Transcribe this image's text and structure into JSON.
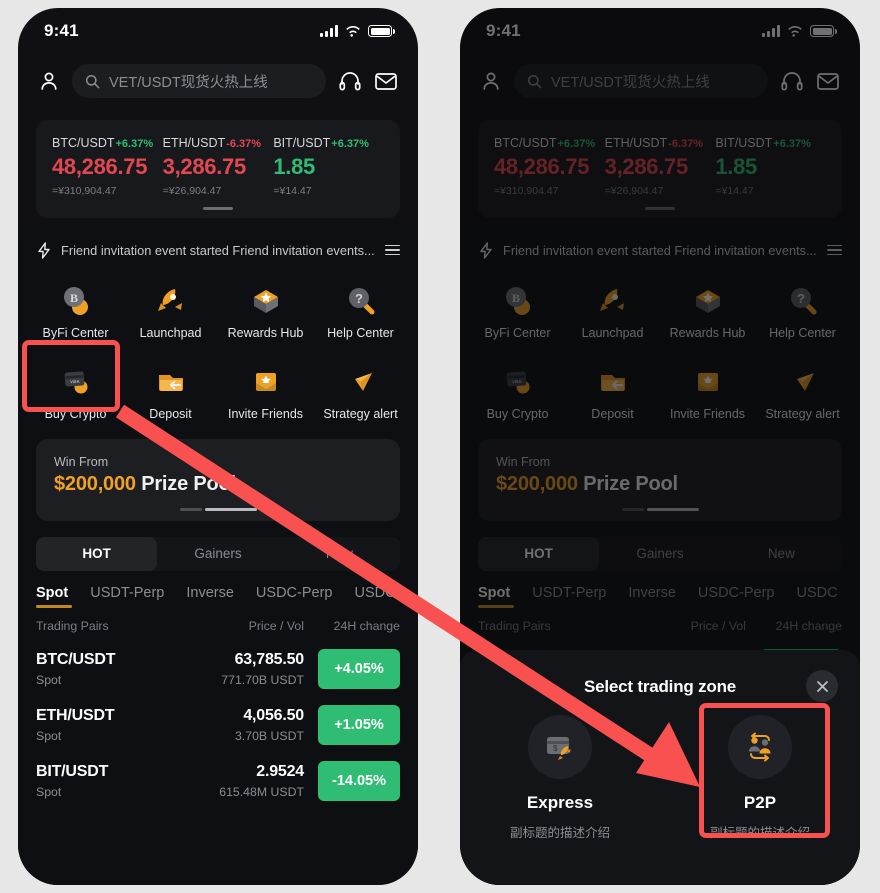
{
  "background_color": "#e7e7e7",
  "accent": {
    "green": "#2ebd73",
    "red": "#e3474f",
    "gold": "#f0a124",
    "highlight": "#f8514f"
  },
  "status_bar": {
    "time": "9:41",
    "signal_icon": "signal-bars-icon",
    "wifi_icon": "wifi-icon",
    "battery_icon": "battery-icon"
  },
  "top_nav": {
    "profile_icon": "profile-icon",
    "search": {
      "icon": "search-icon",
      "placeholder": "VET/USDT现货火热上线",
      "value": ""
    },
    "support_icon": "headset-icon",
    "mail_icon": "envelope-icon"
  },
  "ticker": {
    "items": [
      {
        "pair": "BTC/USDT",
        "change": "+6.37%",
        "direction": "up",
        "price": "48,286.75",
        "price_direction": "down",
        "fiat": "=¥310,904.47"
      },
      {
        "pair": "ETH/USDT",
        "change": "-6.37%",
        "direction": "down",
        "price": "3,286.75",
        "price_direction": "down",
        "fiat": "=¥26,904.47"
      },
      {
        "pair": "BIT/USDT",
        "change": "+6.37%",
        "direction": "up",
        "price": "1.85",
        "price_direction": "up",
        "fiat": "=¥14.47"
      }
    ]
  },
  "announcement": {
    "icon": "lightning-icon",
    "text": "Friend invitation event started Friend invitation events...",
    "menu_icon": "hamburger-menu-icon"
  },
  "quick_actions": [
    {
      "label": "ByFi Center",
      "icon": "bitcoin-coin-icon"
    },
    {
      "label": "Launchpad",
      "icon": "rocket-icon"
    },
    {
      "label": "Rewards Hub",
      "icon": "star-badge-icon"
    },
    {
      "label": "Help Center",
      "icon": "question-magnifier-icon"
    },
    {
      "label": "Buy Crypto",
      "icon": "credit-card-icon"
    },
    {
      "label": "Deposit",
      "icon": "deposit-arrow-icon"
    },
    {
      "label": "Invite Friends",
      "icon": "envelope-star-icon"
    },
    {
      "label": "Strategy alert",
      "icon": "megaphone-icon"
    }
  ],
  "promo": {
    "kicker": "Win From",
    "amount": "$200,000",
    "label": "Prize Pool"
  },
  "segmented": {
    "options": [
      "HOT",
      "Gainers",
      "New"
    ],
    "selected": "HOT"
  },
  "sub_tabs": {
    "options": [
      "Spot",
      "USDT-Perp",
      "Inverse",
      "USDC-Perp",
      "USDC"
    ],
    "selected": "Spot"
  },
  "table": {
    "headers": {
      "pairs": "Trading Pairs",
      "price": "Price / Vol",
      "change": "24H change"
    },
    "rows": [
      {
        "pair": "BTC/USDT",
        "market": "Spot",
        "price": "63,785.50",
        "volume": "771.70B USDT",
        "change": "+4.05%",
        "badge_color": "#2ebd73"
      },
      {
        "pair": "ETH/USDT",
        "market": "Spot",
        "price": "4,056.50",
        "volume": "3.70B USDT",
        "change": "+1.05%",
        "badge_color": "#2ebd73"
      },
      {
        "pair": "BIT/USDT",
        "market": "Spot",
        "price": "2.9524",
        "volume": "615.48M USDT",
        "change": "-14.05%",
        "badge_color": "#2ebd73"
      }
    ]
  },
  "modal": {
    "title": "Select trading zone",
    "close_icon": "close-icon",
    "zones": [
      {
        "name": "Express",
        "subtitle": "副标题的描述介绍",
        "icon": "card-rocket-icon",
        "highlighted": false
      },
      {
        "name": "P2P",
        "subtitle": "副标题的描述介绍",
        "icon": "p2p-exchange-icon",
        "highlighted": true
      }
    ]
  },
  "annotations": {
    "source_highlight": "Buy Crypto",
    "target_highlight": "P2P",
    "arrow": "red-arrow-icon"
  }
}
